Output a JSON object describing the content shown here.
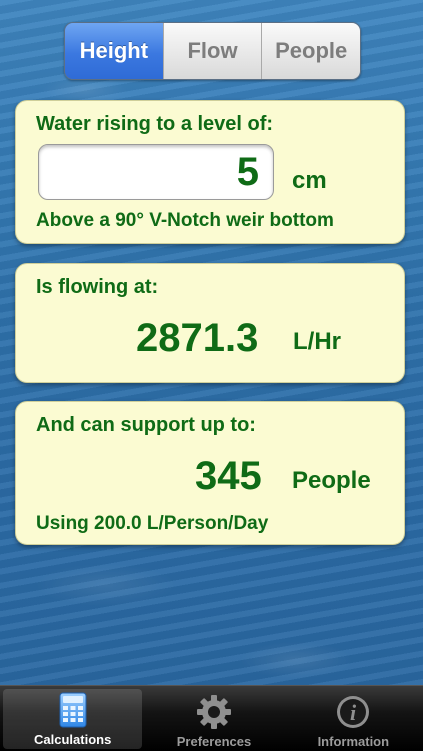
{
  "segments": [
    {
      "label": "Height",
      "active": true
    },
    {
      "label": "Flow",
      "active": false
    },
    {
      "label": "People",
      "active": false
    }
  ],
  "height_panel": {
    "label": "Water rising to a level of:",
    "input_value": "5",
    "unit": "cm",
    "subtitle": "Above a 90° V-Notch weir bottom"
  },
  "flow_panel": {
    "label": "Is flowing at:",
    "value": "2871.3",
    "unit": "L/Hr"
  },
  "people_panel": {
    "label": "And can support up to:",
    "value": "345",
    "unit": "People",
    "subtitle": "Using 200.0 L/Person/Day"
  },
  "tabs": [
    {
      "label": "Calculations",
      "icon": "calculator-icon",
      "active": true
    },
    {
      "label": "Preferences",
      "icon": "gear-icon",
      "active": false
    },
    {
      "label": "Information",
      "icon": "info-icon",
      "active": false
    }
  ],
  "colors": {
    "panel_bg": "#fbfbd2",
    "text_green": "#0f6b16",
    "segment_active": "#3b78e0"
  }
}
